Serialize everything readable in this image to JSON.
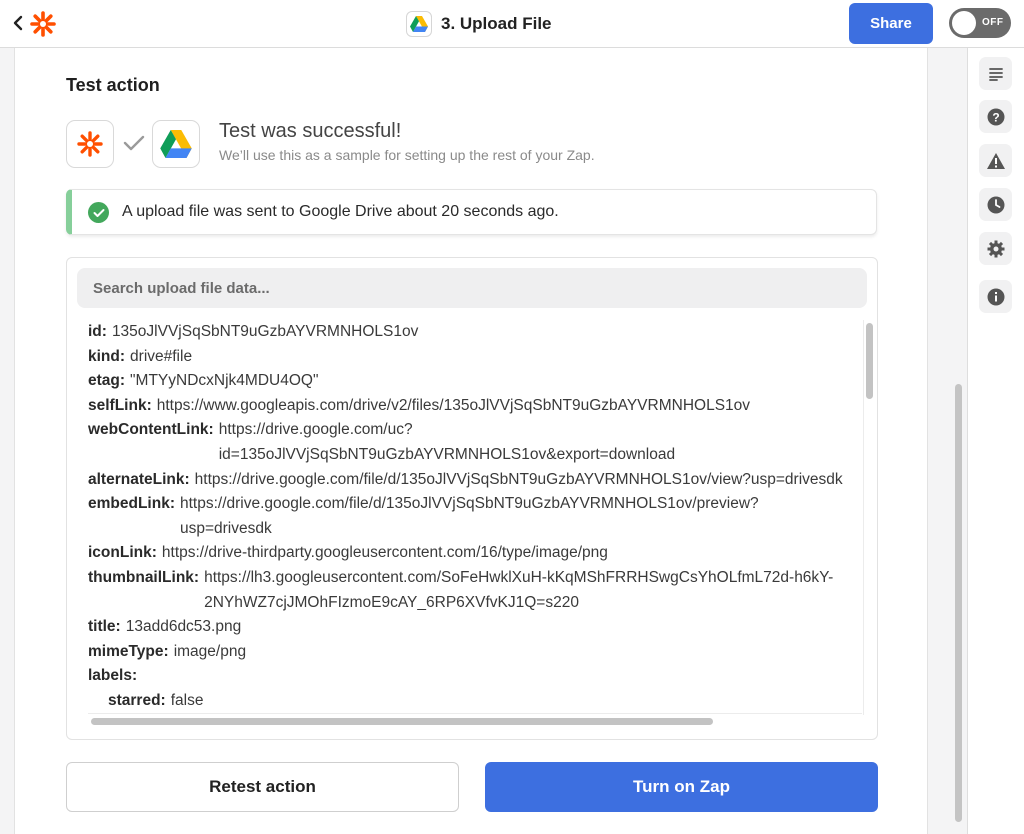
{
  "header": {
    "title": "3. Upload File",
    "share_label": "Share",
    "toggle_label": "OFF",
    "accent": "#3d6fe0"
  },
  "test": {
    "section_title": "Test action",
    "success_title": "Test was successful!",
    "success_subtitle": "We’ll use this as a sample for setting up the rest of your Zap.",
    "alert_text": "A upload file was sent to Google Drive about 20 seconds ago."
  },
  "search": {
    "placeholder": "Search upload file data..."
  },
  "fields": [
    {
      "key": "id:",
      "value": "135oJlVVjSqSbNT9uGzbAYVRMNHOLS1ov"
    },
    {
      "key": "kind:",
      "value": "drive#file"
    },
    {
      "key": "etag:",
      "value": "\"MTYyNDcxNjk4MDU4OQ\""
    },
    {
      "key": "selfLink:",
      "value": "https://www.googleapis.com/drive/v2/files/135oJlVVjSqSbNT9uGzbAYVRMNHOLS1ov"
    },
    {
      "key": "webContentLink:",
      "value": "https://drive.google.com/uc? id=135oJlVVjSqSbNT9uGzbAYVRMNHOLS1ov&export=download"
    },
    {
      "key": "alternateLink:",
      "value": "https://drive.google.com/file/d/135oJlVVjSqSbNT9uGzbAYVRMNHOLS1ov/view?usp=drivesdk"
    },
    {
      "key": "embedLink:",
      "value": "https://drive.google.com/file/d/135oJlVVjSqSbNT9uGzbAYVRMNHOLS1ov/preview? usp=drivesdk"
    },
    {
      "key": "iconLink:",
      "value": "https://drive-thirdparty.googleusercontent.com/16/type/image/png"
    },
    {
      "key": "thumbnailLink:",
      "value": "https://lh3.googleusercontent.com/SoFeHwklXuH-kKqMShFRRHSwgCsYhOLfmL72d-h6kY- 2NYhWZ7cjJMOhFIzmoE9cAY_6RP6XVfvKJ1Q=s220"
    },
    {
      "key": "title:",
      "value": "13add6dc53.png"
    },
    {
      "key": "mimeType:",
      "value": "image/png"
    },
    {
      "key": "labels:",
      "value": ""
    },
    {
      "key": "starred:",
      "value": "false"
    }
  ],
  "actions": {
    "retest_label": "Retest action",
    "turn_on_label": "Turn on Zap"
  },
  "rail_icons": [
    "list-icon",
    "help-icon",
    "warning-icon",
    "clock-icon",
    "gear-icon",
    "info-icon"
  ]
}
